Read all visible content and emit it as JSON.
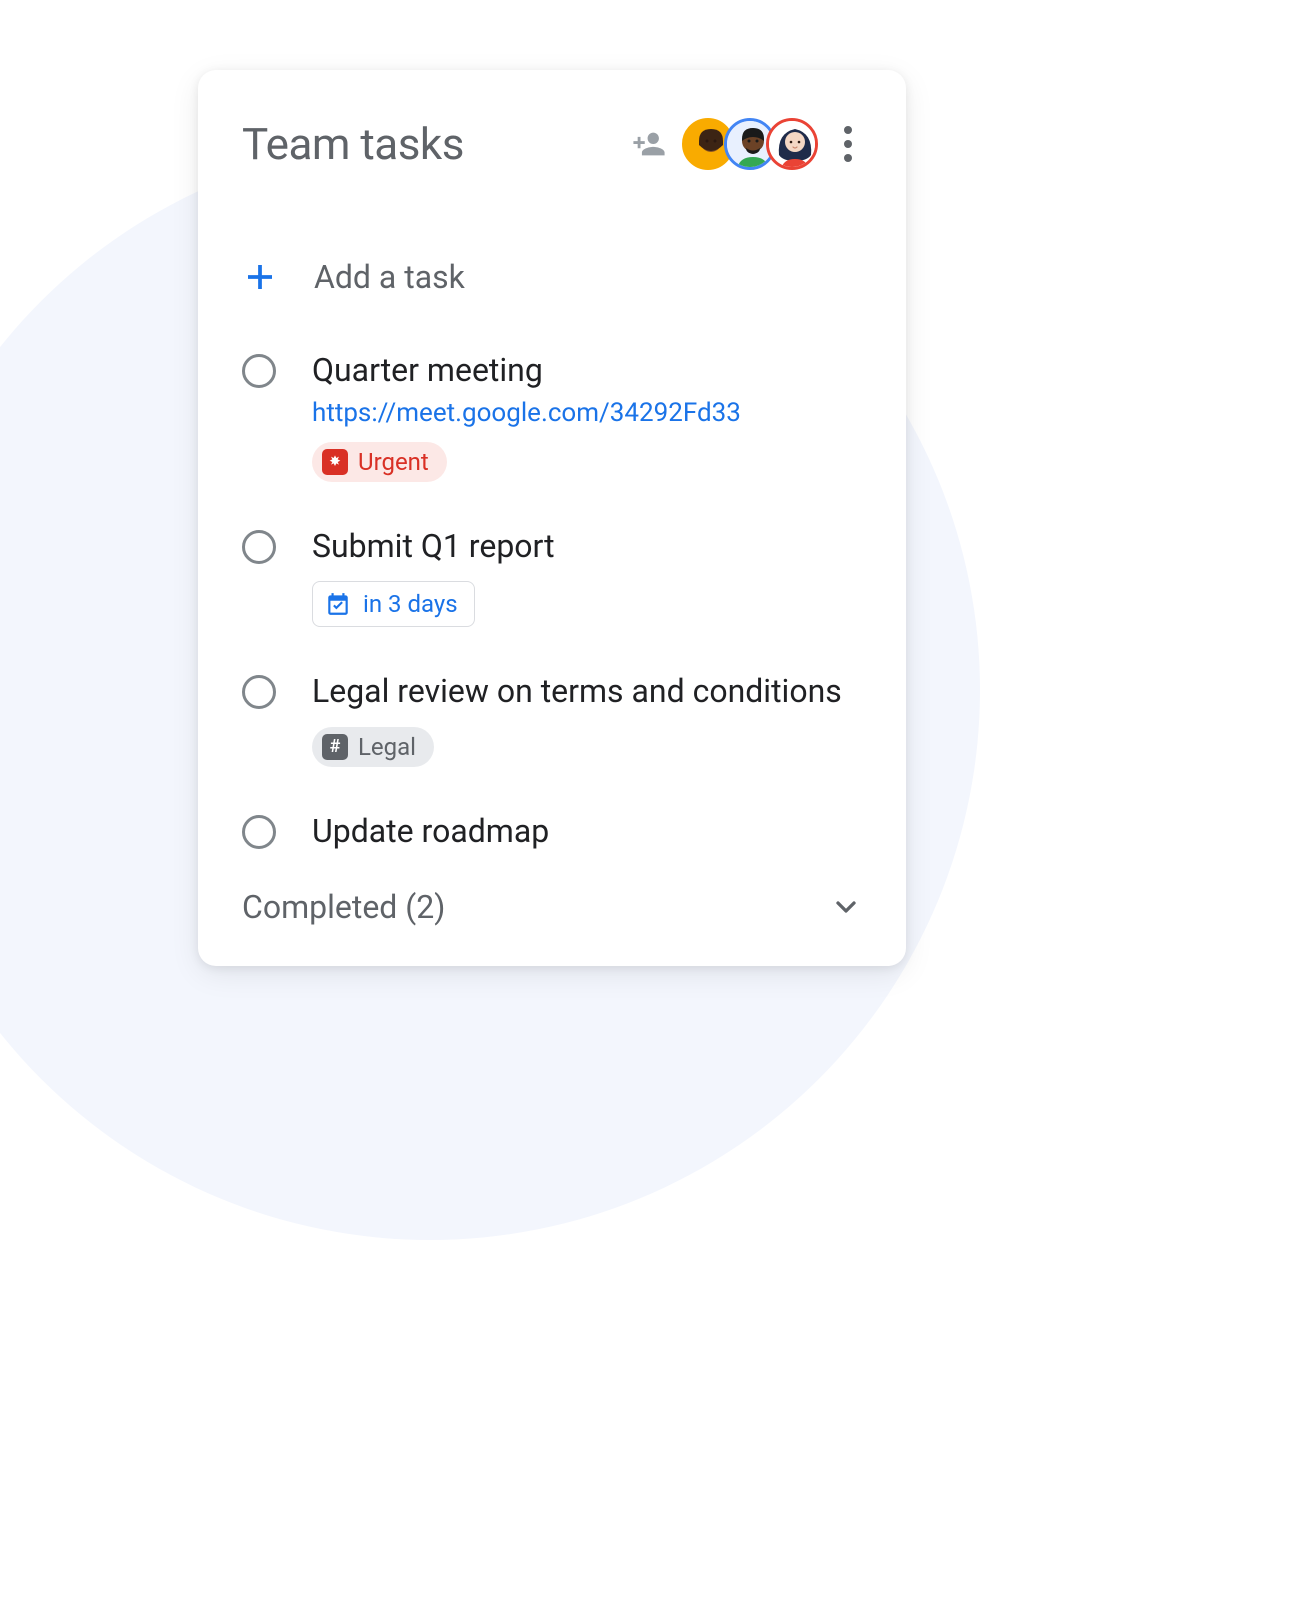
{
  "list_title": "Team tasks",
  "add_task_label": "Add a task",
  "avatars": [
    {
      "ring": "#F9AB00"
    },
    {
      "ring": "#4285F4"
    },
    {
      "ring": "#EA4335"
    }
  ],
  "tasks": [
    {
      "title": "Quarter meeting",
      "link": "https://meet.google.com/34292Fd33",
      "tag": {
        "type": "urgent",
        "label": "Urgent"
      }
    },
    {
      "title": "Submit Q1 report",
      "due": "in 3 days"
    },
    {
      "title": "Legal review on terms and conditions",
      "tag": {
        "type": "legal",
        "label": "Legal"
      }
    },
    {
      "title": "Update roadmap"
    }
  ],
  "completed_label": "Completed (2)",
  "completed_count": 2
}
